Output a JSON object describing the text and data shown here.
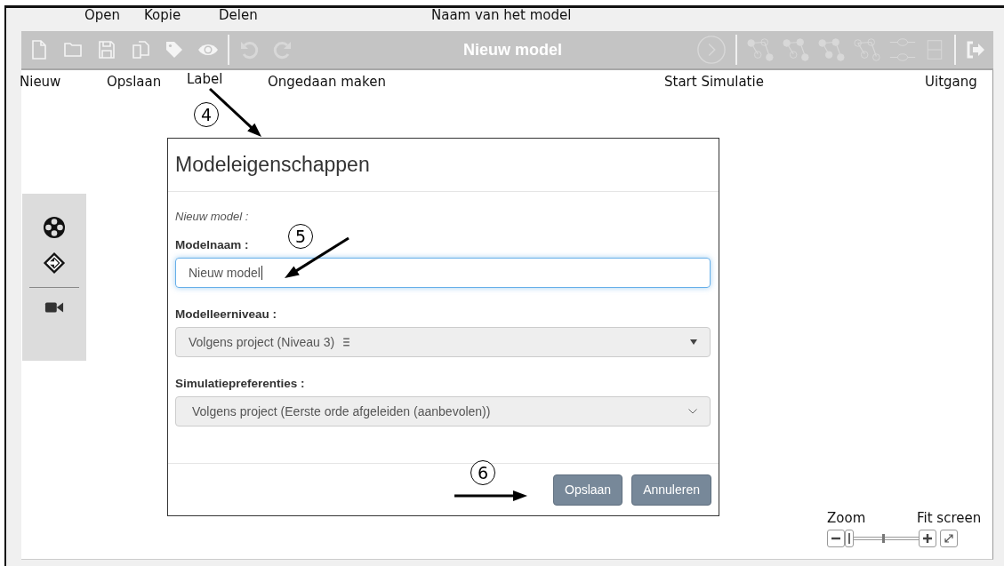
{
  "annotations": {
    "top_labels": [
      "Open",
      "Kopie",
      "Delen",
      "Naam van het model"
    ],
    "bottom_labels": [
      "Nieuw",
      "Opslaan",
      "Label",
      "Ongedaan maken",
      "Start Simulatie",
      "Uitgang"
    ],
    "markers": [
      "4",
      "5",
      "6"
    ]
  },
  "toolbar": {
    "title": "Nieuw model"
  },
  "dialog": {
    "title": "Modeleigenschappen",
    "subtitle": "Nieuw model :",
    "fields": [
      {
        "kind": "text",
        "label": "Modelnaam :",
        "value": "Nieuw model",
        "focused": true
      },
      {
        "kind": "dropdown",
        "label": "Modelleerniveau :",
        "value": "Volgens project (Niveau 3)"
      },
      {
        "kind": "select",
        "label": "Simulatiepreferenties :",
        "value": "Volgens project (Eerste orde afgeleiden (aanbevolen))"
      }
    ],
    "buttons": [
      "Opslaan",
      "Annuleren"
    ]
  },
  "zoom": {
    "label": "Zoom",
    "fit_label": "Fit screen",
    "level": 0
  }
}
